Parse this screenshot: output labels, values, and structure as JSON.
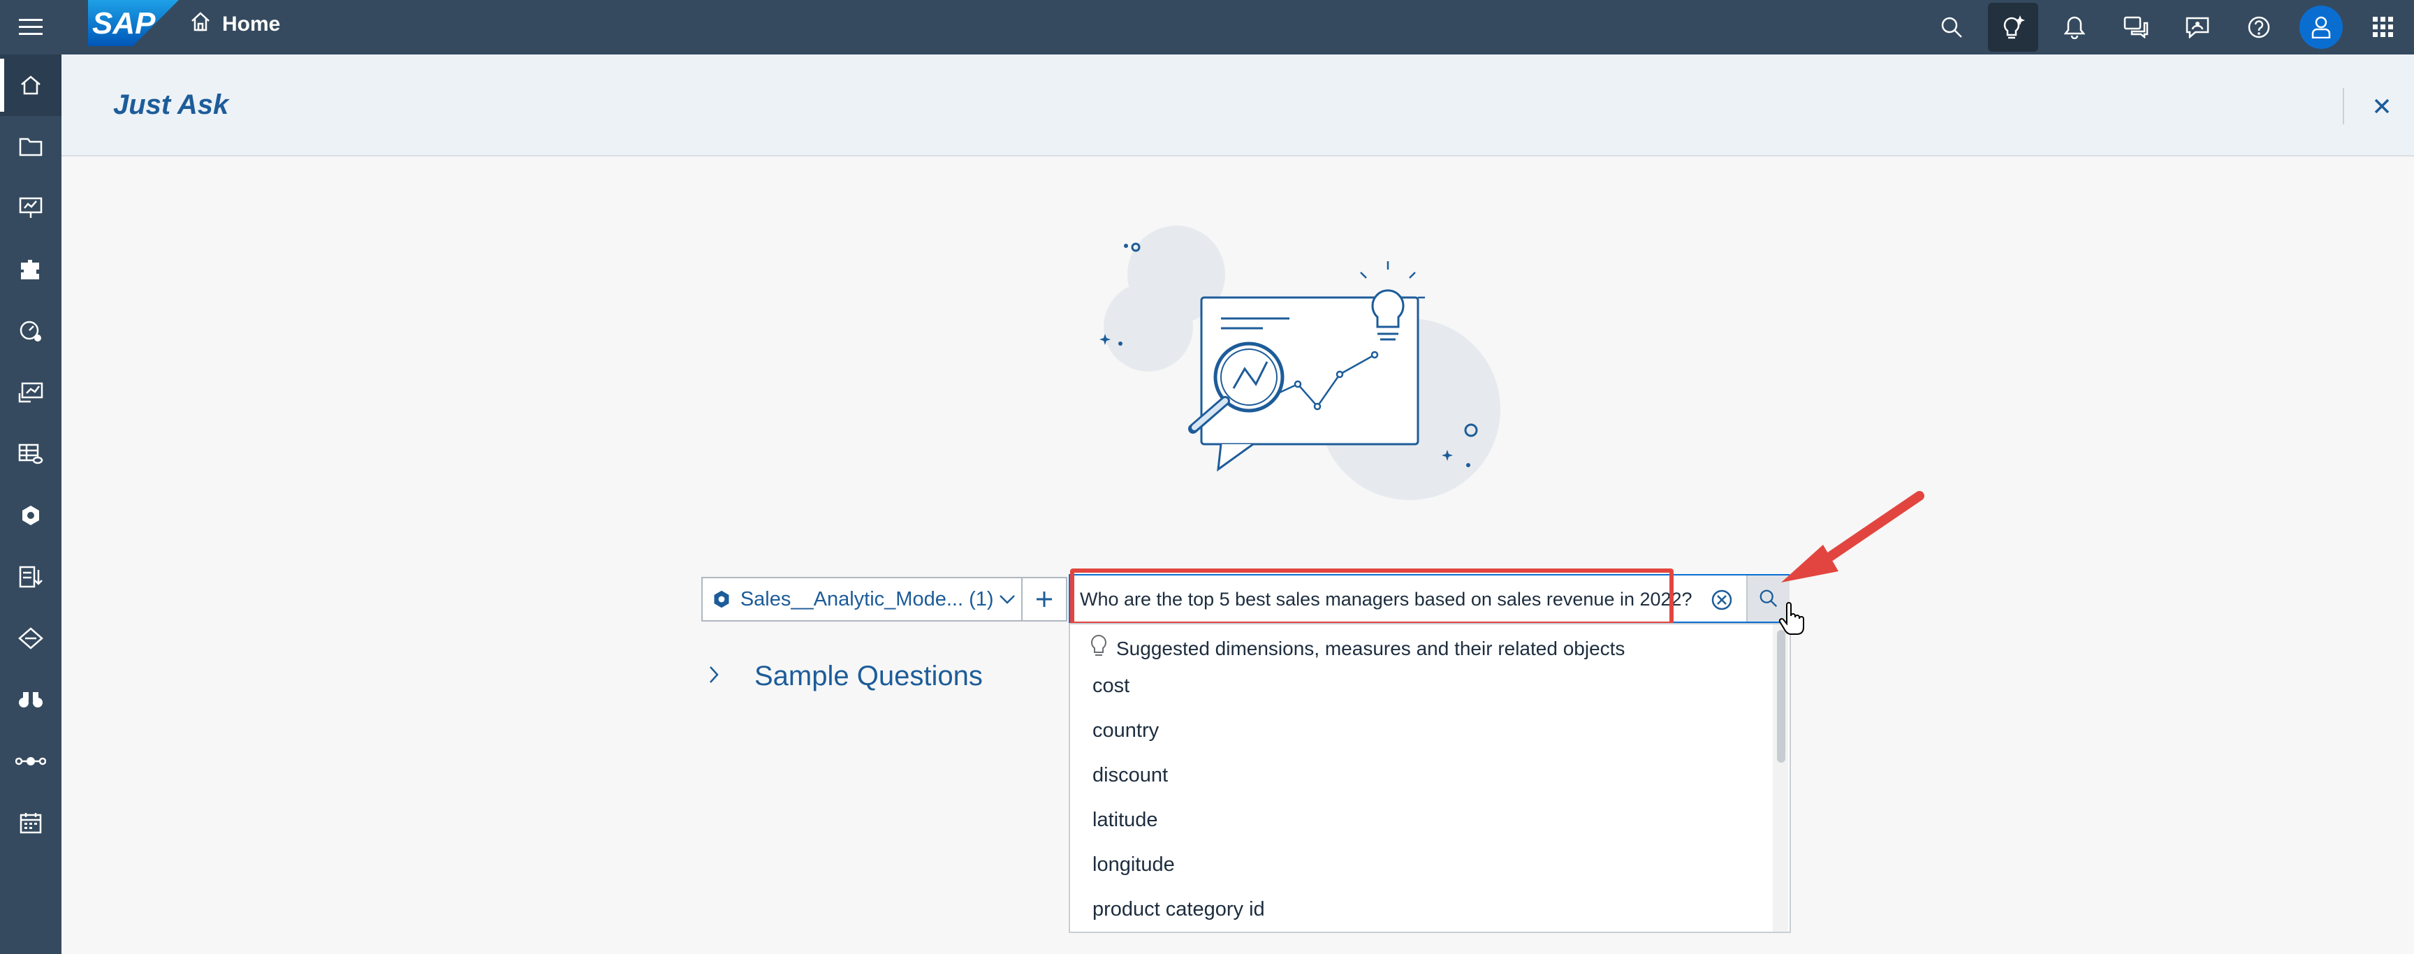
{
  "shell": {
    "home_label": "Home",
    "logo_text": "SAP"
  },
  "page": {
    "title": "Just Ask"
  },
  "query": {
    "model_label": "Sales__Analytic_Mode... (1)",
    "search_value": "Who are the top 5 best sales managers based on sales revenue in 2022?"
  },
  "suggestions": {
    "hint": "Suggested dimensions, measures and their related objects",
    "items": [
      "cost",
      "country",
      "discount",
      "latitude",
      "longitude",
      "product category id"
    ]
  },
  "sample": {
    "label": "Sample Questions"
  },
  "colors": {
    "shell": "#354a5f",
    "accent": "#0a6ed1",
    "highlight": "#e2453f"
  }
}
